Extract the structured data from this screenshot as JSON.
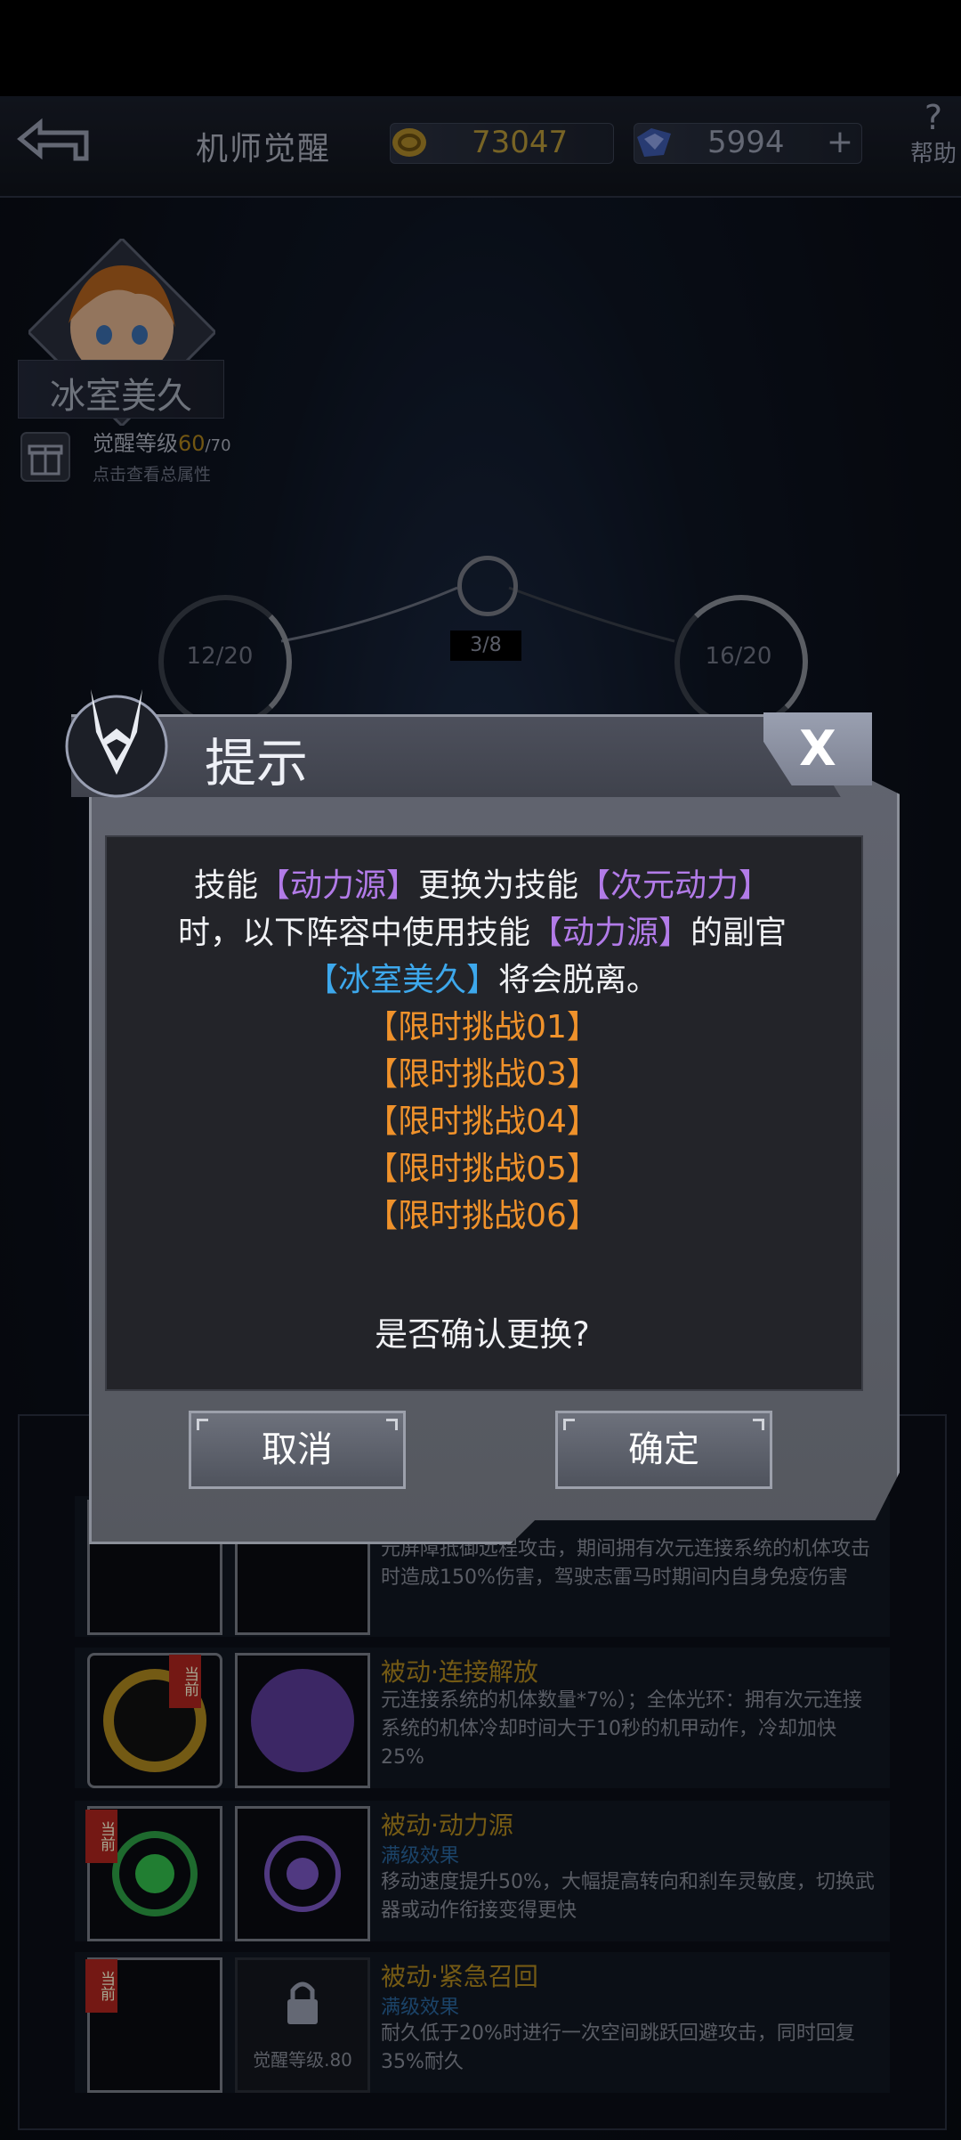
{
  "header": {
    "title": "机师觉醒",
    "gold": "73047",
    "gems": "5994",
    "plus": "+",
    "help_icon_text": "?",
    "help_label": "帮助"
  },
  "character": {
    "name": "冰室美久",
    "awaken_label": "觉醒等级",
    "awaken_current": "60",
    "awaken_max": "/70",
    "awaken_hint": "点击查看总属性"
  },
  "nodes": {
    "left": "12/20",
    "center": "3/8",
    "right": "16/20"
  },
  "skills": [
    {
      "title": "",
      "sub": "",
      "desc": "元屏障抵御远程攻击，期间拥有次元连接系统的机体攻击时造成150%伤害，驾驶志雷马时期间内自身免疫伤害",
      "icon_right_label": ""
    },
    {
      "title": "被动·连接解放",
      "sub": "",
      "desc": "元连接系统的机体数量*7%）；全体光环：拥有次元连接系统的机体冷却时间大于10秒的机甲动作，冷却加快25%",
      "tag": "当前"
    },
    {
      "title": "被动·动力源",
      "sub": "满级效果",
      "desc": "移动速度提升50%，大幅提高转向和刹车灵敏度，切换武器或动作衔接变得更快",
      "tag": "当前"
    },
    {
      "title": "被动·紧急召回",
      "sub": "满级效果",
      "desc": "耐久低于20%时进行一次空间跳跃回避攻击，同时回复35%耐久",
      "tag": "当前",
      "locked_label": "觉醒等级.80"
    }
  ],
  "dialog": {
    "title": "提示",
    "close": "X",
    "line1_a": "技能",
    "line1_skill_old": "【动力源】",
    "line1_b": "更换为技能",
    "line1_skill_new": "【次元动力】",
    "line2_a": "时，以下阵容中使用技能",
    "line2_skill": "【动力源】",
    "line2_b": "的副官",
    "line3_char": "【冰室美久】",
    "line3_b": "将会脱离。",
    "teams": [
      "【限时挑战01】",
      "【限时挑战03】",
      "【限时挑战04】",
      "【限时挑战05】",
      "【限时挑战06】"
    ],
    "question": "是否确认更换?",
    "cancel": "取消",
    "confirm": "确定"
  },
  "colors": {
    "highlight_purple": "#b27be8",
    "highlight_blue": "#3da8ec",
    "highlight_orange": "#f0922b",
    "gold_text": "#b0851c"
  }
}
